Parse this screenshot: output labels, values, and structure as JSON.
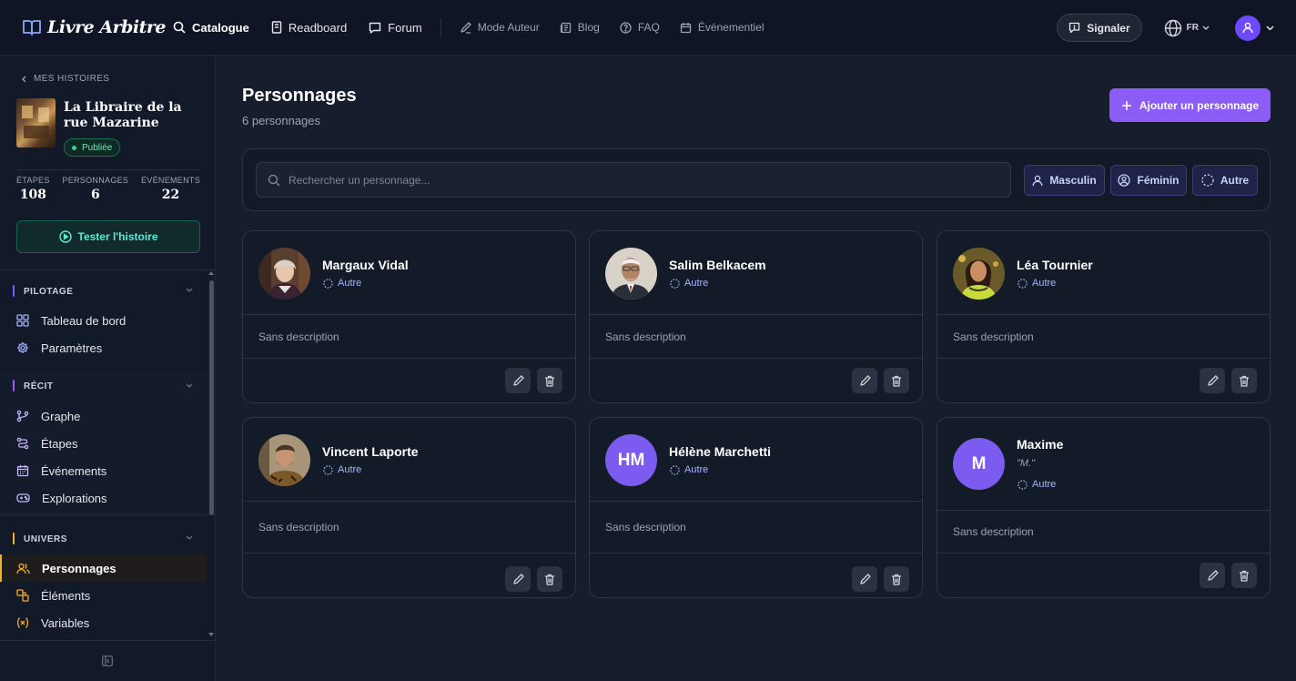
{
  "app": {
    "logo_text": "Livre Arbitre",
    "logo_icon": "book-icon"
  },
  "nav": {
    "items": [
      {
        "label": "Catalogue",
        "icon": "search-icon",
        "active": true
      },
      {
        "label": "Readboard",
        "icon": "book-stack-icon"
      },
      {
        "label": "Forum",
        "icon": "chat-bubble-icon"
      }
    ],
    "secondary": [
      {
        "label": "Mode Auteur",
        "icon": "pen-icon"
      },
      {
        "label": "Blog",
        "icon": "newspaper-icon"
      },
      {
        "label": "FAQ",
        "icon": "help-circle-icon"
      },
      {
        "label": "Événementiel",
        "icon": "calendar-icon"
      }
    ],
    "report_label": "Signaler",
    "language": "FR"
  },
  "sidebar": {
    "back_label": "MES HISTOIRES",
    "story_title": "La Libraire de la rue Mazarine",
    "status": "Publiée",
    "stats": [
      {
        "label": "ÉTAPES",
        "value": "108"
      },
      {
        "label": "PERSONNAGES",
        "value": "6"
      },
      {
        "label": "ÉVÉNEMENTS",
        "value": "22"
      }
    ],
    "test_label": "Tester l'histoire",
    "sections": [
      {
        "title": "PILOTAGE",
        "accent": "#6366f1",
        "items": [
          {
            "label": "Tableau de bord",
            "icon": "dashboard-grid-icon"
          },
          {
            "label": "Paramètres",
            "icon": "gear-icon"
          }
        ]
      },
      {
        "title": "RÉCIT",
        "accent": "#a855f7",
        "items": [
          {
            "label": "Graphe",
            "icon": "git-branch-icon"
          },
          {
            "label": "Étapes",
            "icon": "route-icon"
          },
          {
            "label": "Événements",
            "icon": "calendar-icon"
          },
          {
            "label": "Explorations",
            "icon": "gamepad-icon"
          }
        ]
      },
      {
        "title": "UNIVERS",
        "accent": "#f5b027",
        "items": [
          {
            "label": "Personnages",
            "icon": "users-icon",
            "active": true
          },
          {
            "label": "Éléments",
            "icon": "shapes-icon"
          },
          {
            "label": "Variables",
            "icon": "variable-icon"
          }
        ]
      }
    ]
  },
  "main": {
    "title": "Personnages",
    "subtitle": "6 personnages",
    "add_label": "Ajouter un personnage",
    "search_placeholder": "Rechercher un personnage...",
    "filters": [
      {
        "label": "Masculin",
        "icon": "user-icon"
      },
      {
        "label": "Féminin",
        "icon": "user-circle-icon"
      },
      {
        "label": "Autre",
        "icon": "dashed-circle-icon"
      }
    ],
    "characters": [
      {
        "name": "Margaux Vidal",
        "gender": "Autre",
        "description": "Sans description",
        "avatar": "portrait-photo"
      },
      {
        "name": "Salim Belkacem",
        "gender": "Autre",
        "description": "Sans description",
        "avatar": "portrait-photo"
      },
      {
        "name": "Léa Tournier",
        "gender": "Autre",
        "description": "Sans description",
        "avatar": "portrait-photo"
      },
      {
        "name": "Vincent Laporte",
        "gender": "Autre",
        "description": "Sans description",
        "avatar": "portrait-photo"
      },
      {
        "name": "Hélène Marchetti",
        "gender": "Autre",
        "description": "Sans description",
        "initials": "HM"
      },
      {
        "name": "Maxime",
        "nickname": "\"M.\"",
        "gender": "Autre",
        "description": "Sans description",
        "initials": "M"
      }
    ]
  },
  "colors": {
    "accent": "#8b5cf6",
    "background": "#161d2c",
    "published": "#34d399",
    "test": "#5eead4"
  }
}
